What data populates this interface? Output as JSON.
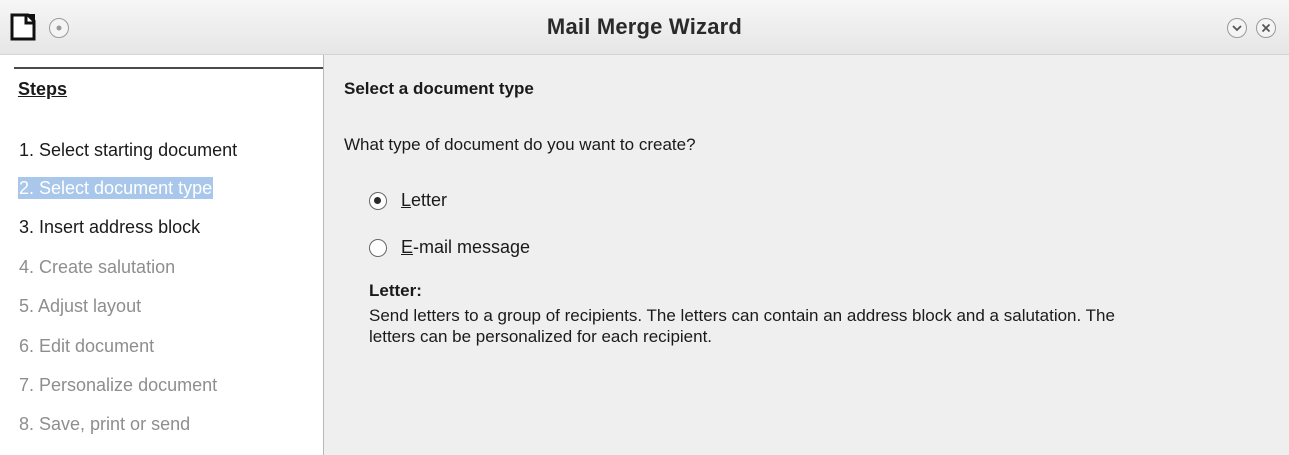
{
  "window": {
    "title": "Mail Merge Wizard"
  },
  "steps": {
    "title": "Steps",
    "items": [
      {
        "label": "1. Select starting document",
        "state": "enabled"
      },
      {
        "label": "2. Select document type",
        "state": "current"
      },
      {
        "label": "3. Insert address block",
        "state": "enabled"
      },
      {
        "label": "4. Create salutation",
        "state": "disabled"
      },
      {
        "label": "5. Adjust layout",
        "state": "disabled"
      },
      {
        "label": "6. Edit document",
        "state": "disabled"
      },
      {
        "label": "7. Personalize document",
        "state": "disabled"
      },
      {
        "label": "8. Save, print or send",
        "state": "disabled"
      }
    ]
  },
  "content": {
    "heading": "Select a document type",
    "question": "What type of document do you want to create?",
    "options": [
      {
        "mnemonic": "L",
        "rest": "etter",
        "checked": true
      },
      {
        "mnemonic": "E",
        "rest": "-mail message",
        "checked": false
      }
    ],
    "description_title": "Letter:",
    "description_text": "Send letters to a group of recipients. The letters can contain an address block and a salutation. The letters can be personalized for each recipient."
  },
  "colors": {
    "selection": "#a8c7ea",
    "disabled_text": "#8e8e8e"
  },
  "icons": {
    "app": "document-icon",
    "menu": "window-menu-icon",
    "minimize": "minimize-icon",
    "close": "close-icon"
  }
}
